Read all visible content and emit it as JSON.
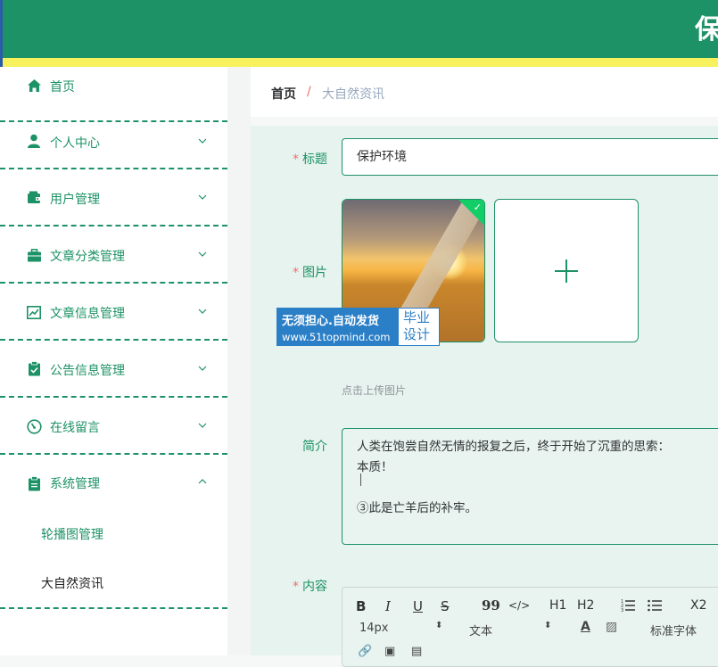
{
  "header": {
    "title": "保"
  },
  "sidebar": {
    "items": [
      {
        "label": "首页",
        "icon": "home-icon"
      },
      {
        "label": "个人中心",
        "icon": "user-icon"
      },
      {
        "label": "用户管理",
        "icon": "wallet-icon"
      },
      {
        "label": "文章分类管理",
        "icon": "briefcase-icon"
      },
      {
        "label": "文章信息管理",
        "icon": "chart-icon"
      },
      {
        "label": "公告信息管理",
        "icon": "clipboard-check-icon"
      },
      {
        "label": "在线留言",
        "icon": "gauge-icon"
      },
      {
        "label": "系统管理",
        "icon": "document-icon"
      }
    ],
    "submenu": [
      {
        "label": "轮播图管理",
        "active": true
      },
      {
        "label": "大自然资讯",
        "active": false
      }
    ]
  },
  "breadcrumb": {
    "home": "首页",
    "separator": "/",
    "current": "大自然资讯"
  },
  "form": {
    "title": {
      "label": "标题",
      "value": "保护环境"
    },
    "image": {
      "label": "图片",
      "hint": "点击上传图片"
    },
    "intro": {
      "label": "简介",
      "lines": [
        "人类在饱尝自然无情的报复之后，终于开始了沉重的思索：",
        "本质！",
        "",
        "③此是亡羊后的补牢。"
      ]
    },
    "content": {
      "label": "内容"
    }
  },
  "watermark": {
    "line1": "无须担心.自动发货",
    "line2": "www.51topmind.com",
    "right1": "毕业",
    "right2": "设计"
  },
  "editor": {
    "buttons": [
      "B",
      "I",
      "U",
      "S",
      "99",
      "</>",
      "H1",
      "H2",
      "ordered-list",
      "bullet-list",
      "X2"
    ],
    "size": "14px",
    "block": "文本",
    "font": "标准字体"
  },
  "colors": {
    "primary": "#1d9266",
    "accent_yellow": "#f6f15d",
    "required": "#f56c6c",
    "content_bg": "#e6f3ee"
  }
}
